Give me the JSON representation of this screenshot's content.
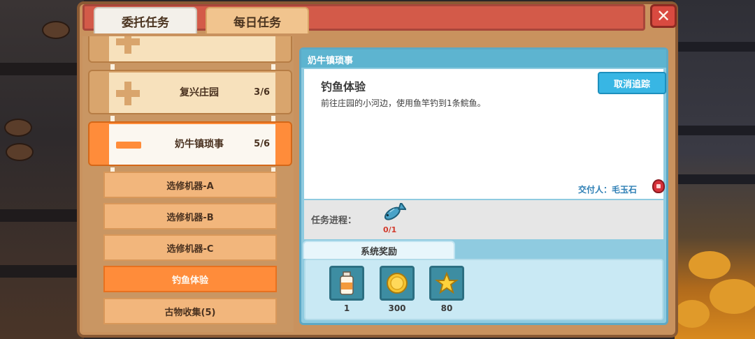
{
  "tabs": [
    {
      "label": "委托任务",
      "active": true
    },
    {
      "label": "每日任务",
      "active": false
    }
  ],
  "close_label": "✕",
  "categories": [
    {
      "name": "",
      "count": "",
      "expanded": false
    },
    {
      "name": "复兴庄园",
      "count": "3/6",
      "expanded": false
    },
    {
      "name": "奶牛镇琐事",
      "count": "5/6",
      "expanded": true
    }
  ],
  "subquests": [
    {
      "label": "选修机器-A",
      "active": false
    },
    {
      "label": "选修机器-B",
      "active": false
    },
    {
      "label": "选修机器-C",
      "active": false
    },
    {
      "label": "钓鱼体验",
      "active": true
    },
    {
      "label": "古物收集(5)",
      "active": false
    }
  ],
  "detail": {
    "header": "奶牛镇琐事",
    "quest_title": "钓鱼体验",
    "quest_desc": "前往庄园的小河边，使用鱼竿钓到1条鲩鱼。",
    "untrack_label": "取消追踪",
    "giver_label": "交付人：毛玉石",
    "progress_label": "任务进程：",
    "progress_count": "0/1",
    "progress_icon": "fish-icon",
    "reward_tab_label": "系统奖励",
    "rewards": [
      {
        "icon": "milk-bottle-icon",
        "qty": "1"
      },
      {
        "icon": "gold-coin-icon",
        "qty": "300"
      },
      {
        "icon": "star-icon",
        "qty": "80"
      }
    ]
  },
  "colors": {
    "accent_orange": "#ff8c3a",
    "title_red": "#d35a49",
    "panel_blue": "#8fcbe0",
    "button_blue": "#38b6e4"
  }
}
